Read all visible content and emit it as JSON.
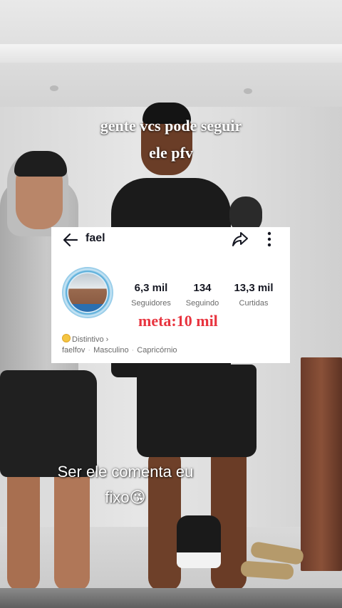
{
  "video_captions": {
    "top_line1": "gente vcs pode seguir",
    "top_line2": "ele pfv",
    "bottom_line1": "Ser ele comenta eu",
    "bottom_line2": "fixo",
    "bottom_emoji": "😘"
  },
  "profile_card": {
    "username": "fael",
    "icons": [
      "back-arrow-icon",
      "share-icon",
      "more-vertical-icon"
    ],
    "stats": [
      {
        "value": "6,3 mil",
        "label": "Seguidores"
      },
      {
        "value": "134",
        "label": "Seguindo"
      },
      {
        "value": "13,3 mil",
        "label": "Curtidas"
      }
    ],
    "goal_text": "meta:10 mil",
    "badge_label": "Distintivo ›",
    "info": [
      "faelfov",
      "Masculino",
      "Capricórnio"
    ],
    "colors": {
      "goal": "#e8343f",
      "text": "#161823",
      "muted": "#6a6a6a"
    }
  }
}
